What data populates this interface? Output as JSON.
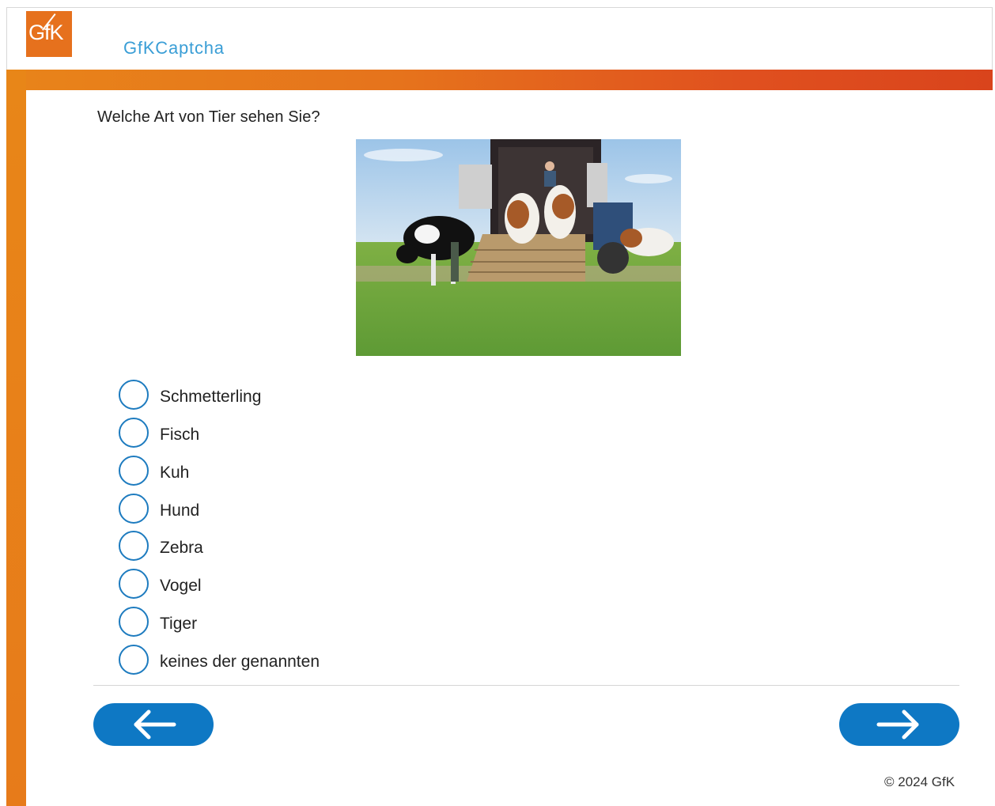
{
  "header": {
    "logo_text": "GfK",
    "app_title": "GfKCaptcha"
  },
  "question": "Welche Art von Tier sehen Sie?",
  "options": [
    "Schmetterling",
    "Fisch",
    "Kuh",
    "Hund",
    "Zebra",
    "Vogel",
    "Tiger",
    "keines der genannten"
  ],
  "navigation": {
    "back_icon": "arrow-left-icon",
    "next_icon": "arrow-right-icon"
  },
  "footer": {
    "copyright": "© 2024 GfK"
  },
  "colors": {
    "brand_orange": "#e6711d",
    "accent_blue": "#0e78c4",
    "title_blue": "#3a9ed6"
  }
}
